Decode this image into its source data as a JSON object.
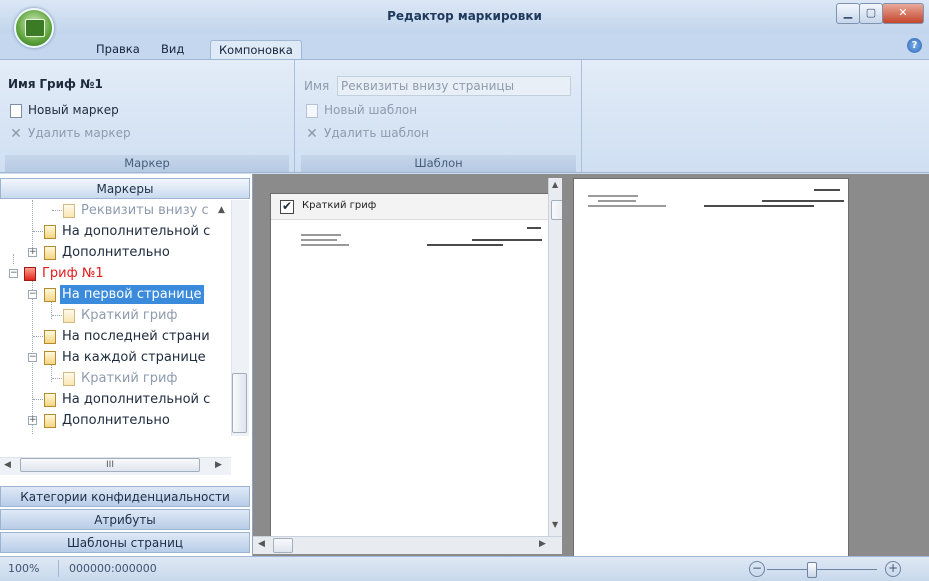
{
  "window": {
    "title": "Редактор маркировки",
    "help_glyph": "?"
  },
  "tabs": [
    {
      "label": "Правка"
    },
    {
      "label": "Вид"
    },
    {
      "label": "Компоновка"
    }
  ],
  "ribbon": {
    "marker_group": {
      "name_caption": "Имя",
      "name_value": "Гриф №1",
      "new_label": "Новый маркер",
      "delete_label": "Удалить маркер",
      "group_label": "Маркер"
    },
    "template_group": {
      "name_caption": "Имя",
      "name_value": "Реквизиты внизу страницы",
      "new_label": "Новый шаблон",
      "delete_label": "Удалить шаблон",
      "group_label": "Шаблон"
    }
  },
  "left_panel": {
    "markers_header": "Маркеры",
    "tree": [
      {
        "label": "Реквизиты внизу с"
      },
      {
        "label": "На дополнительной с"
      },
      {
        "label": "Дополнительно"
      },
      {
        "label": "Гриф №1"
      },
      {
        "label": "На первой странице"
      },
      {
        "label": "Краткий гриф"
      },
      {
        "label": "На последней страни"
      },
      {
        "label": "На каждой странице"
      },
      {
        "label": "Краткий гриф"
      },
      {
        "label": "На дополнительной с"
      },
      {
        "label": "Дополнительно"
      }
    ],
    "hscroll_grip": "III",
    "sections": [
      {
        "label": "Категории конфиденциальности"
      },
      {
        "label": "Атрибуты"
      },
      {
        "label": "Шаблоны страниц"
      }
    ]
  },
  "preview": {
    "checkbox_checked": true,
    "check_glyph": "✔",
    "short_stamp_label": "Краткий гриф"
  },
  "status": {
    "zoom": "100%",
    "coords": "000000:000000",
    "zoom_out": "−",
    "zoom_in": "+"
  },
  "colors": {
    "accent": "#3a8bdb",
    "red_node": "#e21b1b",
    "panel_bg": "#cfdcec"
  },
  "icons": [
    "app-orb-icon",
    "minimize-icon",
    "maximize-icon",
    "close-icon",
    "help-icon",
    "document-icon",
    "delete-x-icon",
    "stamp-red-icon",
    "checkbox-icon",
    "zoom-out-icon",
    "zoom-in-icon"
  ]
}
